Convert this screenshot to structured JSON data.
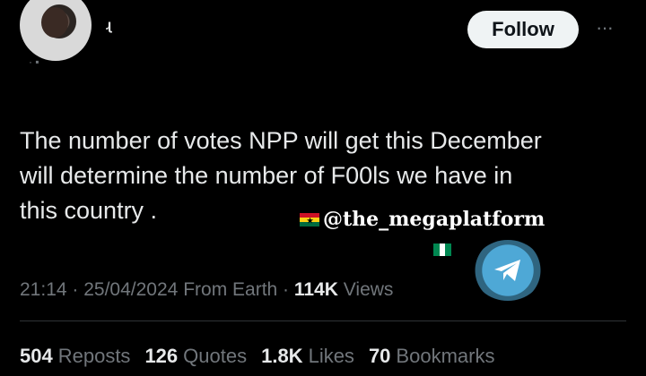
{
  "header": {
    "name_fragment": "ɻ",
    "handle_fragment": "·  ▪",
    "follow_label": "Follow",
    "more_label": "···"
  },
  "tweet": {
    "text": "The number of votes NPP will get this December\nwill determine the number of F00ls we have in\nthis country .",
    "time": "21:14",
    "date": "25/04/2024",
    "source": "From Earth",
    "views_count": "114K",
    "views_label": "Views"
  },
  "watermark": {
    "text": "@the_megaplatform",
    "flag_ghana": "ghana-flag-icon",
    "flag_nigeria": "nigeria-flag-icon",
    "badge": "telegram-icon"
  },
  "stats": [
    {
      "count": "504",
      "label": "Reposts"
    },
    {
      "count": "126",
      "label": "Quotes"
    },
    {
      "count": "1.8K",
      "label": "Likes"
    },
    {
      "count": "70",
      "label": "Bookmarks"
    }
  ],
  "colors": {
    "background": "#000000",
    "text": "#e7e9ea",
    "muted": "#71767b",
    "follow_bg": "#eff3f4",
    "telegram": "#4ea8d6"
  }
}
